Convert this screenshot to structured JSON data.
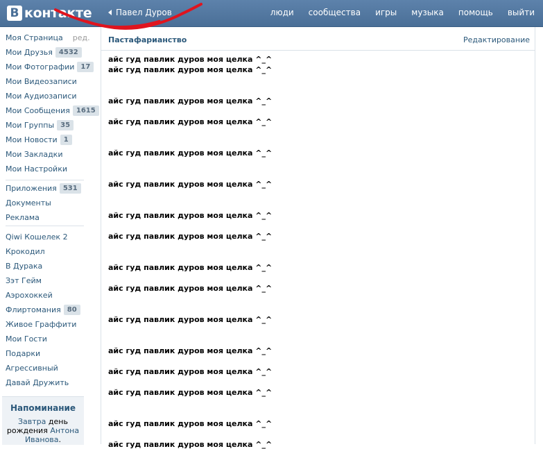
{
  "header": {
    "logo_letter": "В",
    "logo_text": "контакте",
    "back_label": "Павел Дуров",
    "nav": [
      "люди",
      "сообщества",
      "игры",
      "музыка",
      "помощь",
      "выйти"
    ]
  },
  "sidebar": {
    "edit_label": "ред.",
    "items": [
      {
        "label": "Моя Страница",
        "badge": ""
      },
      {
        "label": "Мои Друзья",
        "badge": "4532"
      },
      {
        "label": "Мои Фотографии",
        "badge": "17"
      },
      {
        "label": "Мои Видеозаписи",
        "badge": ""
      },
      {
        "label": "Мои Аудиозаписи",
        "badge": ""
      },
      {
        "label": "Мои Сообщения",
        "badge": "1615"
      },
      {
        "label": "Мои Группы",
        "badge": "35"
      },
      {
        "label": "Мои Новости",
        "badge": "1"
      },
      {
        "label": "Мои Закладки",
        "badge": ""
      },
      {
        "label": "Мои Настройки",
        "badge": ""
      },
      {
        "label": "Приложения",
        "badge": "531"
      },
      {
        "label": "Документы",
        "badge": ""
      },
      {
        "label": "Реклама",
        "badge": ""
      },
      {
        "label": "Qiwi Кошелек 2",
        "badge": ""
      },
      {
        "label": "Крокодил",
        "badge": ""
      },
      {
        "label": "В Дурака",
        "badge": ""
      },
      {
        "label": "Зэт Гейм",
        "badge": ""
      },
      {
        "label": "Аэрохоккей",
        "badge": ""
      },
      {
        "label": "Флиртомания",
        "badge": "80"
      },
      {
        "label": "Живое Граффити",
        "badge": ""
      },
      {
        "label": "Мои Гости",
        "badge": ""
      },
      {
        "label": "Подарки",
        "badge": ""
      },
      {
        "label": "Агрессивный",
        "badge": ""
      },
      {
        "label": "Давай Дружить",
        "badge": ""
      }
    ],
    "reminder": {
      "title": "Напоминание",
      "when": "Завтра",
      "text": "день рождения",
      "person": "Антона Иванова",
      "period": "."
    }
  },
  "main": {
    "title": "Пастафарианство",
    "edit_label": "Редактирование",
    "post_text": "айс гуд павлик дуров моя целка ^_^",
    "post_count": 17
  },
  "colors": {
    "header": "#4a6f97",
    "link": "#2b587a",
    "badge_bg": "#dae2e8",
    "scribble": "#e0141e"
  },
  "icons": {
    "back": "triangle-left-icon"
  }
}
